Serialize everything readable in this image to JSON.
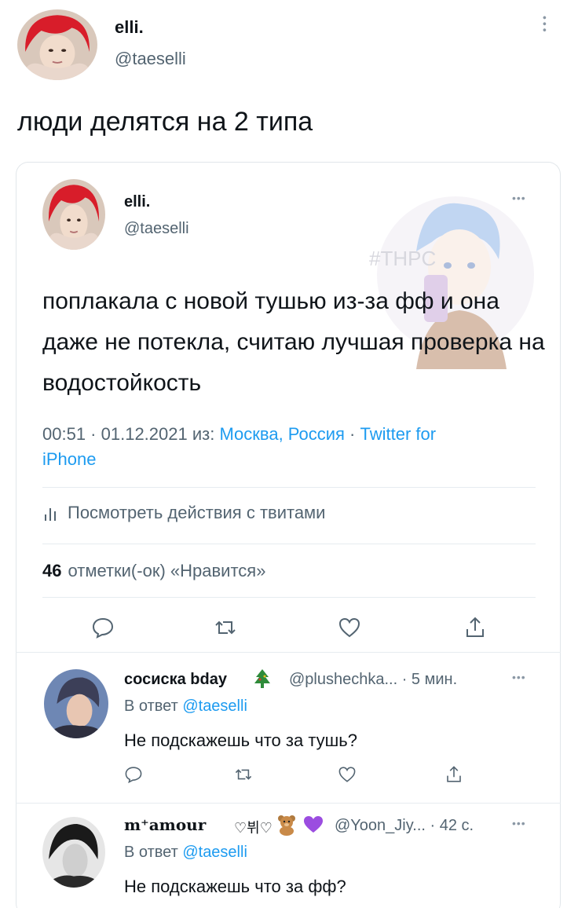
{
  "outer_tweet": {
    "display_name": "elli.",
    "handle": "@taeselli",
    "more_icon": "more-vertical-icon",
    "text": "люди делятся на 2 типа"
  },
  "quoted_tweet": {
    "display_name": "elli.",
    "handle": "@taeselli",
    "more_icon": "more-horizontal-icon",
    "text": "поплакала с новой тушью из-за фф и она даже не потекла, считаю лучшая проверка на водостойкость",
    "watermark_text": "#THPC",
    "meta": {
      "time": "00:51",
      "sep1": " · ",
      "date": "01.12.2021",
      "from_prefix": " из: ",
      "location": "Москва, Россия",
      "sep2": " · ",
      "client_part1": "Twitter for",
      "client_part2": "iPhone"
    },
    "activity_label": "Посмотреть действия с твитами",
    "likes_count": "46",
    "likes_label": "отметки(-ок) «Нравится»",
    "actions": [
      "reply-icon",
      "retweet-icon",
      "like-icon",
      "share-icon"
    ]
  },
  "replies": [
    {
      "display_name": "сосиска bday",
      "emoji": "christmas-tree-icon",
      "handle_time": "@plushechka... · 5 мин.",
      "reply_prefix": "В ответ ",
      "reply_to": "@taeselli",
      "text": "Не подскажешь что за тушь?"
    },
    {
      "display_name": "m⁺amour",
      "decoration": "♡뷔♡",
      "emojis": [
        "teddy-bear-icon",
        "purple-heart-icon"
      ],
      "handle_time": "@Yoon_Jiy... · 42 с.",
      "reply_prefix": "В ответ ",
      "reply_to": "@taeselli",
      "text": "Не подскажешь что за фф?"
    }
  ],
  "colors": {
    "link": "#1d9bf0",
    "secondary_text": "#536471",
    "primary_text": "#0f1419"
  }
}
